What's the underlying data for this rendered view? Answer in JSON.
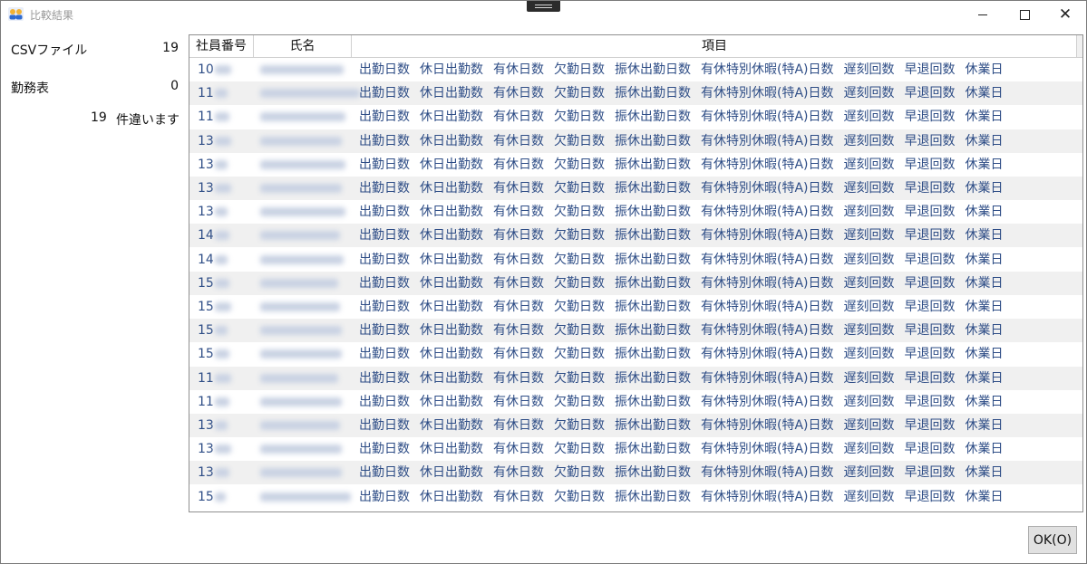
{
  "window": {
    "title": "比較結果",
    "icon": "people-icon"
  },
  "summary": {
    "csv_label": "CSVファイル",
    "csv_count": "19",
    "kinmu_label": "勤務表",
    "kinmu_count": "0",
    "diff_count": "19",
    "diff_text": "件違います"
  },
  "grid": {
    "headers": {
      "employee_no": "社員番号",
      "name": "氏名",
      "items": "項目"
    },
    "item_labels": [
      "出勤日数",
      "休日出勤数",
      "有休日数",
      "欠勤日数",
      "振休出勤日数",
      "有休特別休暇(特A)日数",
      "遅刻回数",
      "早退回数",
      "休業日"
    ],
    "rows": [
      {
        "id": "10"
      },
      {
        "id": "11"
      },
      {
        "id": "11"
      },
      {
        "id": "13"
      },
      {
        "id": "13"
      },
      {
        "id": "13"
      },
      {
        "id": "13"
      },
      {
        "id": "14"
      },
      {
        "id": "14"
      },
      {
        "id": "15"
      },
      {
        "id": "15"
      },
      {
        "id": "15"
      },
      {
        "id": "15"
      },
      {
        "id": "11"
      },
      {
        "id": "11"
      },
      {
        "id": "13"
      },
      {
        "id": "13"
      },
      {
        "id": "13"
      },
      {
        "id": "15"
      }
    ]
  },
  "buttons": {
    "ok": "OK(O)"
  }
}
